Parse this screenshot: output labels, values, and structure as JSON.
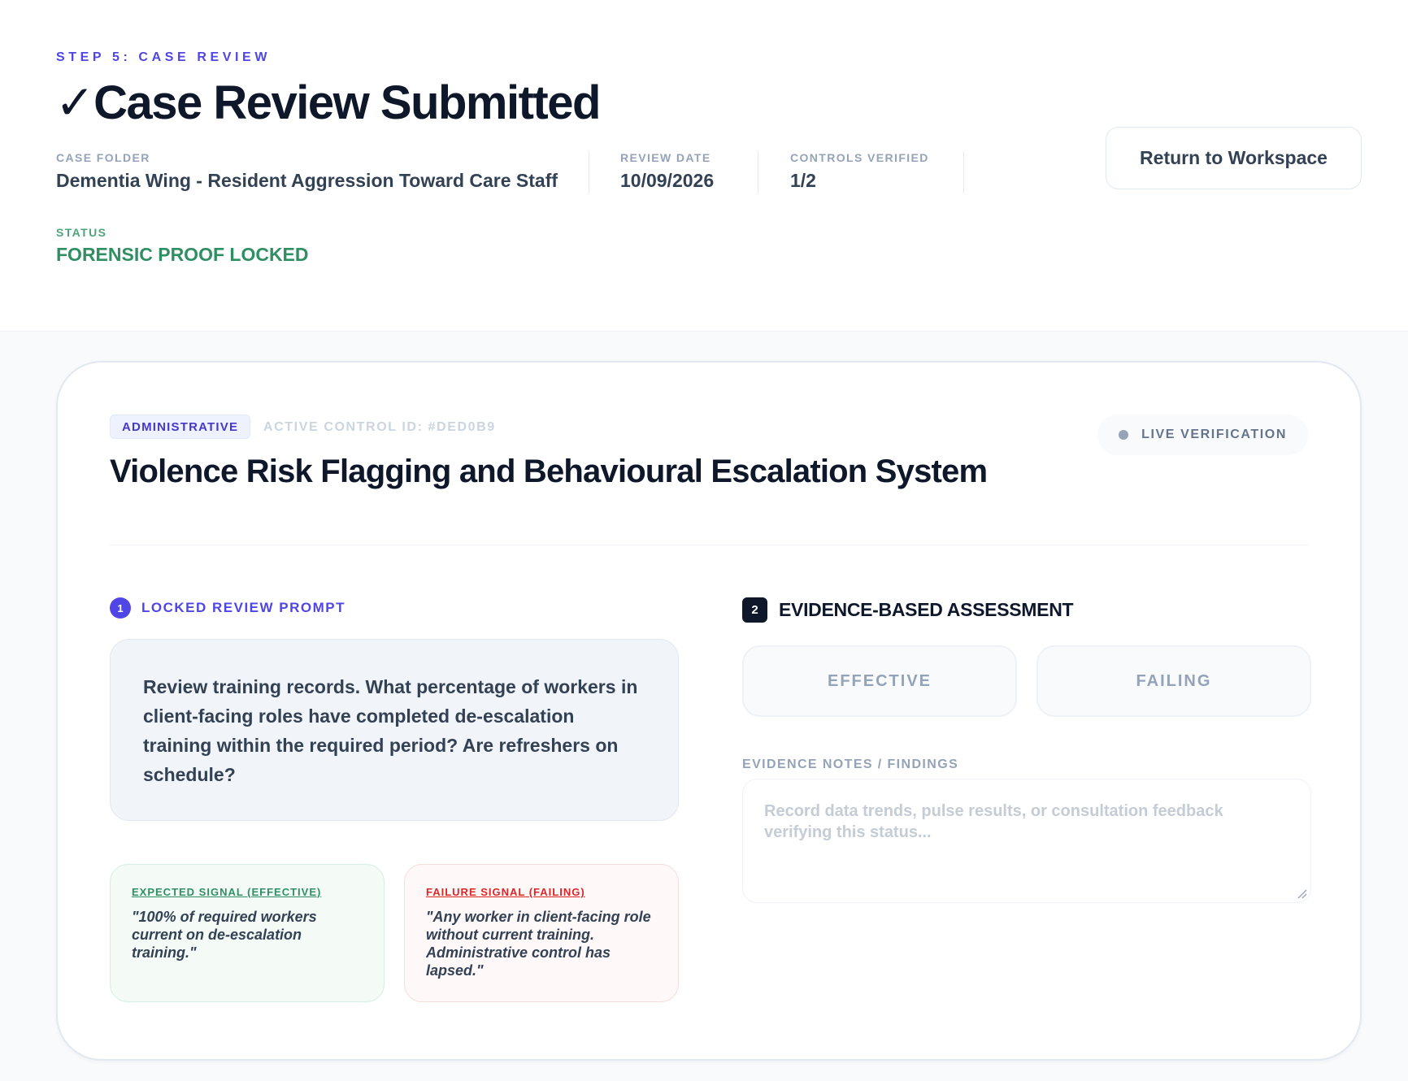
{
  "header": {
    "step_label": "STEP 5: CASE REVIEW",
    "check_glyph": "✓",
    "title": "Case Review Submitted",
    "case_folder_label": "CASE FOLDER",
    "case_folder_value": "Dementia Wing - Resident Aggression Toward Care Staff",
    "review_date_label": "REVIEW DATE",
    "review_date_value": "10/09/2026",
    "controls_verified_label": "CONTROLS VERIFIED",
    "controls_verified_value": "1/2",
    "status_label": "STATUS",
    "status_value": "FORENSIC PROOF LOCKED",
    "return_button": "Return to Workspace"
  },
  "control": {
    "category": "ADMINISTRATIVE",
    "active_id": "ACTIVE CONTROL ID: #DED0B9",
    "live_label": "LIVE VERIFICATION",
    "title": "Violence Risk Flagging and Behavioural Escalation System"
  },
  "review_prompt": {
    "number": "1",
    "label": "LOCKED REVIEW PROMPT",
    "text": "Review training records. What percentage of workers in client-facing roles have completed de-escalation training within the required period? Are refreshers on schedule?",
    "expected_label": "EXPECTED SIGNAL (EFFECTIVE)",
    "expected_text": "\"100% of required workers current on de-escalation training.\"",
    "failure_label": "FAILURE SIGNAL (FAILING)",
    "failure_text": "\"Any worker in client-facing role without current training. Administrative control has lapsed.\""
  },
  "assessment": {
    "number": "2",
    "label": "EVIDENCE-BASED ASSESSMENT",
    "effective_button": "EFFECTIVE",
    "failing_button": "FAILING",
    "notes_label": "EVIDENCE NOTES / FINDINGS",
    "notes_placeholder": "Record data trends, pulse results, or consultation feedback verifying this status...",
    "notes_value": ""
  },
  "colors": {
    "accent": "#4f46e5",
    "status_green": "#2f8f63",
    "failure_red": "#dc2626",
    "ink": "#0f172a"
  },
  "icons": [
    "checkmark-icon",
    "live-dot-icon",
    "resize-handle-icon"
  ]
}
